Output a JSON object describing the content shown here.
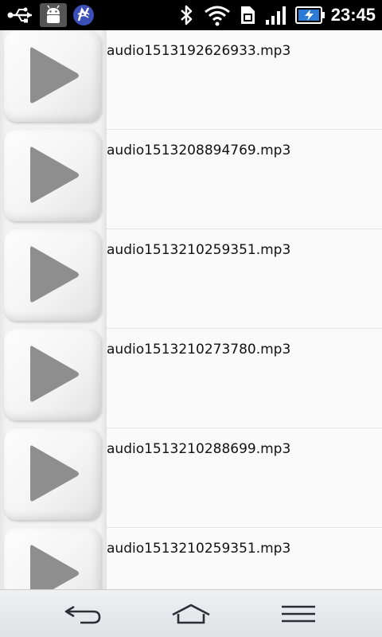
{
  "status_bar": {
    "time": "23:45",
    "icons": [
      "usb-icon",
      "android-debug-icon",
      "app-notification-icon",
      "bluetooth-icon",
      "wifi-icon",
      "sim-icon",
      "signal-icon",
      "battery-charging-icon"
    ],
    "accent_color": "#ffffff",
    "battery_color": "#2b7bd6"
  },
  "files": [
    {
      "name": "audio1513192626933.mp3"
    },
    {
      "name": "audio1513208894769.mp3"
    },
    {
      "name": "audio1513210259351.mp3"
    },
    {
      "name": "audio1513210273780.mp3"
    },
    {
      "name": "audio1513210288699.mp3"
    },
    {
      "name": "audio1513210259351.mp3"
    }
  ],
  "nav_bar": {
    "buttons": [
      "back-icon",
      "home-icon",
      "menu-icon"
    ]
  }
}
